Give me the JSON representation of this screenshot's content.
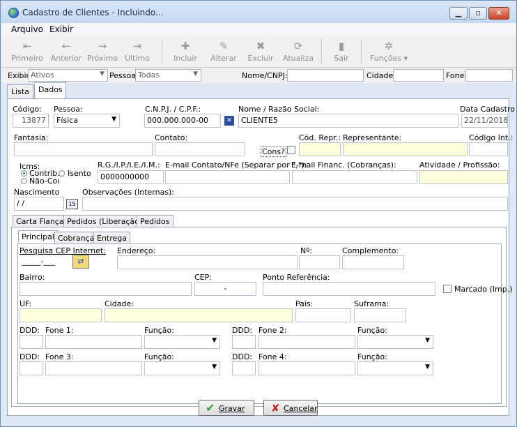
{
  "window": {
    "title": "Cadastro de Clientes - Incluindo..."
  },
  "menu": [
    "Arquivo",
    "Exibir"
  ],
  "toolbar": [
    {
      "label": "Primeiro",
      "icon": "first-record-icon"
    },
    {
      "label": "Anterior",
      "icon": "previous-record-icon"
    },
    {
      "label": "Próximo",
      "icon": "next-record-icon"
    },
    {
      "label": "Último",
      "icon": "last-record-icon"
    },
    {
      "label": "Incluir",
      "icon": "add-icon"
    },
    {
      "label": "Alterar",
      "icon": "edit-icon"
    },
    {
      "label": "Excluir",
      "icon": "delete-icon"
    },
    {
      "label": "Atualiza",
      "icon": "refresh-icon"
    },
    {
      "label": "Sair",
      "icon": "exit-icon"
    },
    {
      "label": "Funções",
      "icon": "functions-icon"
    }
  ],
  "filter": {
    "exibir_label": "Exibir:",
    "exibir_value": "Ativos",
    "pessoa_label": "Pessoa:",
    "pessoa_value": "Todas",
    "nome_label": "Nome/CNPJ:",
    "cidade_label": "Cidade:",
    "fone_label": "Fone:"
  },
  "tabs": [
    "Lista",
    "Dados"
  ],
  "form": {
    "codigo_label": "Código:",
    "codigo": "13877",
    "pessoa_label": "Pessoa:",
    "pessoa": "Física",
    "cnpj_label": "C.N.P.J. / C.P.F.:",
    "cnpj": "000.000.000-00",
    "nome_label": "Nome / Razão Social:",
    "nome": "CLIENTE5",
    "data_label": "Data Cadastro",
    "data": "22/11/2018",
    "fantasia_label": "Fantasia:",
    "contato_label": "Contato:",
    "cons_label": "Cons?",
    "cod_repr_label": "Cód. Repr.:",
    "representante_label": "Representante:",
    "codigo_int_label": "Código Int.:",
    "icms_label": "Icms:",
    "icms_contrib": "Contrib.",
    "icms_isento": "Isento",
    "icms_nao": "Não-Coı",
    "rg_label": "R.G./I.P./I.E./I.M.:",
    "rg": "0000000000",
    "email_label": "E-mail Contato/NFe (Separar por \",\"):",
    "email_financ_label": "E-mail Financ. (Cobranças):",
    "atividade_label": "Atividade / Profissão:",
    "nascimento_label": "Nascimento",
    "nascimento": " / /",
    "cal_icon": "15",
    "obs_label": "Observações (Internas):"
  },
  "subtabs": [
    "Carta Fiança",
    "Pedidos (Liberação)",
    "Pedidos"
  ],
  "innertabs": [
    "Principal",
    "Cobrança",
    "Entrega"
  ],
  "address": {
    "cep_search_label": "Pesquisa CEP Internet:",
    "cep_search_value": "_____-___",
    "endereco_label": "Endereço:",
    "numero_label": "Nº:",
    "complemento_label": "Complemento:",
    "bairro_label": "Bairro:",
    "cep_label": "CEP:",
    "cep_value": "-",
    "ponto_label": "Ponto Referência:",
    "marcado_label": "Marcado (Imp.)",
    "uf_label": "UF:",
    "cidade_label": "Cidade:",
    "pais_label": "País:",
    "suframa_label": "Suframa:",
    "ddd_label": "DDD:",
    "fone1_label": "Fone 1:",
    "fone2_label": "Fone 2:",
    "fone3_label": "Fone 3:",
    "fone4_label": "Fone 4:",
    "funcao_label": "Função:"
  },
  "buttons": {
    "gravar": "Gravar",
    "cancelar": "Cancelar"
  }
}
